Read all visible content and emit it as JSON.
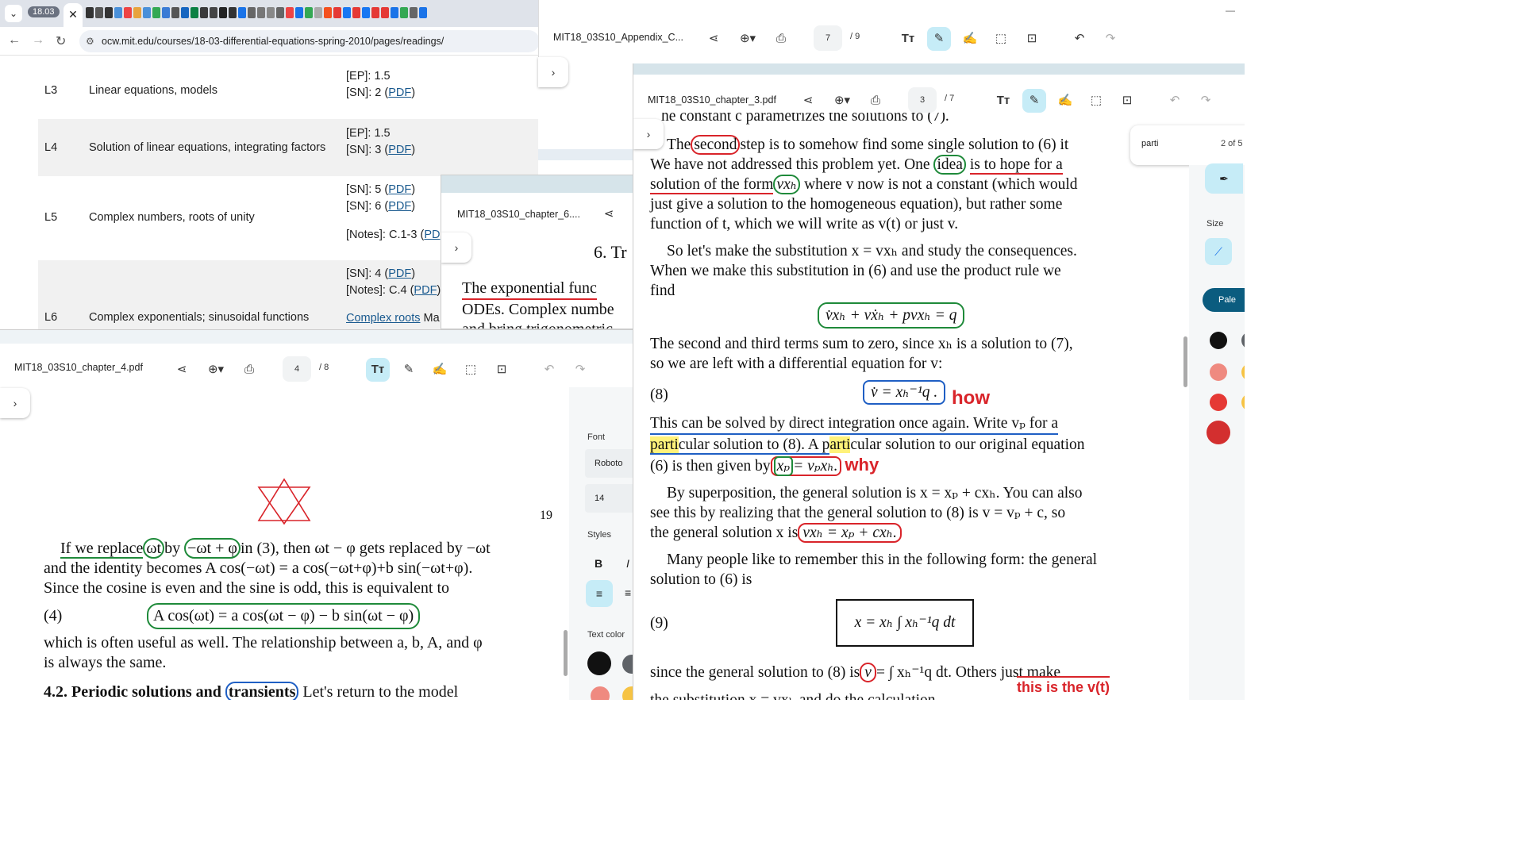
{
  "browser": {
    "version_badge": "18.03",
    "close_tab_icon": "close-icon",
    "url": "ocw.mit.edu/courses/18-03-differential-equations-spring-2010/pages/readings/"
  },
  "webpage": {
    "rows": [
      {
        "lec": "L3",
        "topic": "Linear equations, models",
        "readings": [
          "[EP]: 1.5",
          "[SN]: 2 ("
        ],
        "links": [
          "PDF"
        ]
      },
      {
        "lec": "L4",
        "topic": "Solution of linear equations, integrating factors",
        "readings": [
          "[EP]: 1.5",
          "[SN]: 3 ("
        ],
        "links": [
          "PDF"
        ]
      },
      {
        "lec": "L5",
        "topic": "Complex numbers, roots of unity",
        "readings": [
          "[SN]: 5 (",
          "[SN]: 6 (",
          "[Notes]: C.1-3 ("
        ],
        "links": [
          "PDF",
          "PDF",
          "PD"
        ]
      },
      {
        "lec": "L6",
        "topic": "Complex exponentials; sinusoidal functions",
        "readings": [
          "[SN]: 4 (",
          "[Notes]: C.4 ("
        ],
        "links": [
          "PDF",
          "PDF",
          "Complex roots"
        ],
        "trail": "Ma"
      }
    ]
  },
  "pdf_appendix": {
    "filename": "MIT18_03S10_Appendix_C...",
    "page": "7",
    "total": "/ 9"
  },
  "pdf_ch6": {
    "filename": "MIT18_03S10_chapter_6....",
    "heading": "6. Tr",
    "lines": [
      "The exponential func",
      "ODEs. Complex numbe",
      "and bring trigonometric"
    ]
  },
  "pdf_ch4": {
    "filename": "MIT18_03S10_chapter_4.pdf",
    "page": "4",
    "total": "/ 8",
    "page_number": "19",
    "text": {
      "l1a": "If we replace",
      "l1b": "ωt",
      "l1c": "by",
      "l1d": "−ωt + φ",
      "l1e": "in (3), then ωt − φ gets replaced by −ωt",
      "l2": "and the identity becomes A cos(−ωt) = a cos(−ωt+φ)+b sin(−ωt+φ).",
      "l3": "Since the cosine is even and the sine is odd, this is equivalent to",
      "eqnum": "(4)",
      "eq": "A cos(ωt) = a cos(ωt − φ) − b sin(ωt − φ)",
      "l5": "which is often useful as well. The relationship between a, b, A, and φ",
      "l6": "is always the same.",
      "l7a": "4.2. Periodic solutions and",
      "l7b": "transients",
      "l7c": "Let's return to the model"
    },
    "panel": {
      "font_label": "Font",
      "font_value": "Roboto",
      "size_value": "14",
      "styles_label": "Styles",
      "bold": "B",
      "italic": "I",
      "text_color_label": "Text color"
    }
  },
  "pdf_ch3": {
    "filename": "MIT18_03S10_chapter_3.pdf",
    "page": "3",
    "total": "/ 7",
    "search": {
      "query": "parti",
      "count": "2 of 5"
    },
    "panel": {
      "size_label": "Size",
      "palette_label": "Pale"
    },
    "text": {
      "l0": "he constant c parametrizes the solutions to (7).",
      "l1a": "The",
      "l1b": "second",
      "l1c": "step is to somehow find some single solution to (6) it",
      "l2a": "We have not addressed this problem yet. One",
      "l2b": "idea",
      "l2c": "is to hope for a",
      "l3a": "solution of the form",
      "l3b": "vxₕ",
      "l3c": "where v now is not a constant (which would",
      "l4": "just give a solution to the homogeneous equation), but rather some",
      "l5": "function of t, which we will write as v(t) or just v.",
      "l6": "So let's make the substitution x = vxₕ and study the consequences.",
      "l7": "When we make this substitution in (6) and use the product rule we",
      "l8": "find",
      "eq1": "v̇xₕ + vẋₕ + pvxₕ = q",
      "l9": "The second and third terms sum to zero, since xₕ is a solution to (7),",
      "l10": "so we are left with a differential equation for v:",
      "eq8num": "(8)",
      "eq8": "v̇ = xₕ⁻¹q .",
      "ann_how": "how",
      "l11": "This can be solved by direct integration once again. Write vₚ for a",
      "l12a": "parti",
      "l12b": "cular solution to (8). A p",
      "l12c": "arti",
      "l12d": "cular solution to our original equation",
      "l13a": "(6) is then given by",
      "l13b": "xₚ",
      "l13c": "= vₚxₕ.",
      "ann_why": "why",
      "l14": "By superposition, the general solution is x = xₚ + cxₕ. You can also",
      "l15": "see this by realizing that the general solution to (8) is v = vₚ + c, so",
      "l16a": "the general solution x is",
      "l16b": "vxₕ = xₚ + cxₕ.",
      "l17": "Many people like to remember this in the following form: the general",
      "l18": "solution to (6) is",
      "eq9num": "(9)",
      "eq9": "x = xₕ ∫ xₕ⁻¹q dt",
      "l19a": "since the general solution to (8) is",
      "l19b": "v",
      "l19c": "= ∫ xₕ⁻¹q dt. Others just make",
      "ann_v": "this is the v(t)",
      "l20": "the substitution x = vxₕ and do the calculation."
    }
  },
  "colors": {
    "accent_toggle": "#c6ecf7",
    "ink_red": "#d9242a",
    "ink_green": "#1f8a3a",
    "ink_blue": "#1f5fc4",
    "highlight": "#fff27a"
  }
}
